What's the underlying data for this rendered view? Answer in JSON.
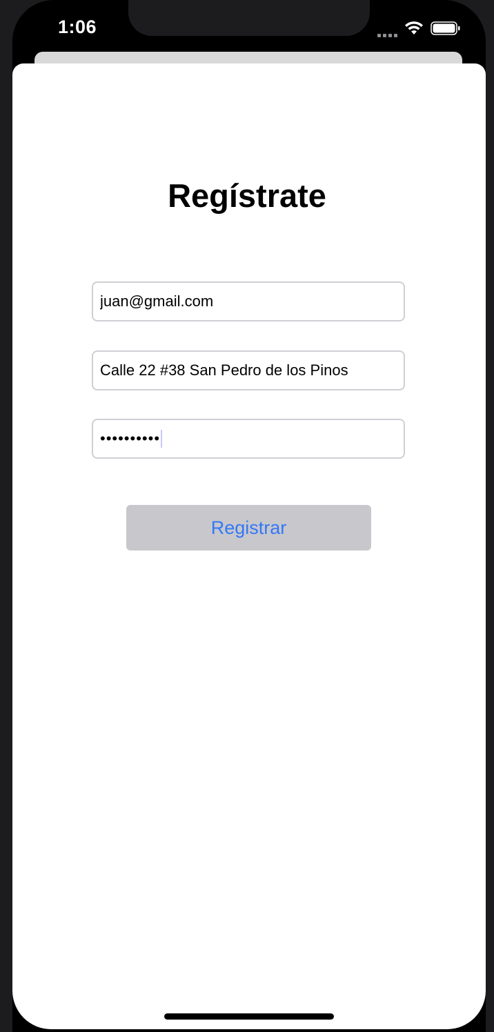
{
  "status_bar": {
    "time": "1:06",
    "wifi_icon": "wifi-icon",
    "battery_icon": "battery-icon"
  },
  "form": {
    "title": "Regístrate",
    "email_value": "juan@gmail.com",
    "address_value": "Calle 22 #38 San Pedro de los Pinos",
    "password_masked": "••••••••••",
    "submit_label": "Registrar"
  },
  "colors": {
    "button_bg": "#c7c7cc",
    "button_text": "#3478f6"
  }
}
